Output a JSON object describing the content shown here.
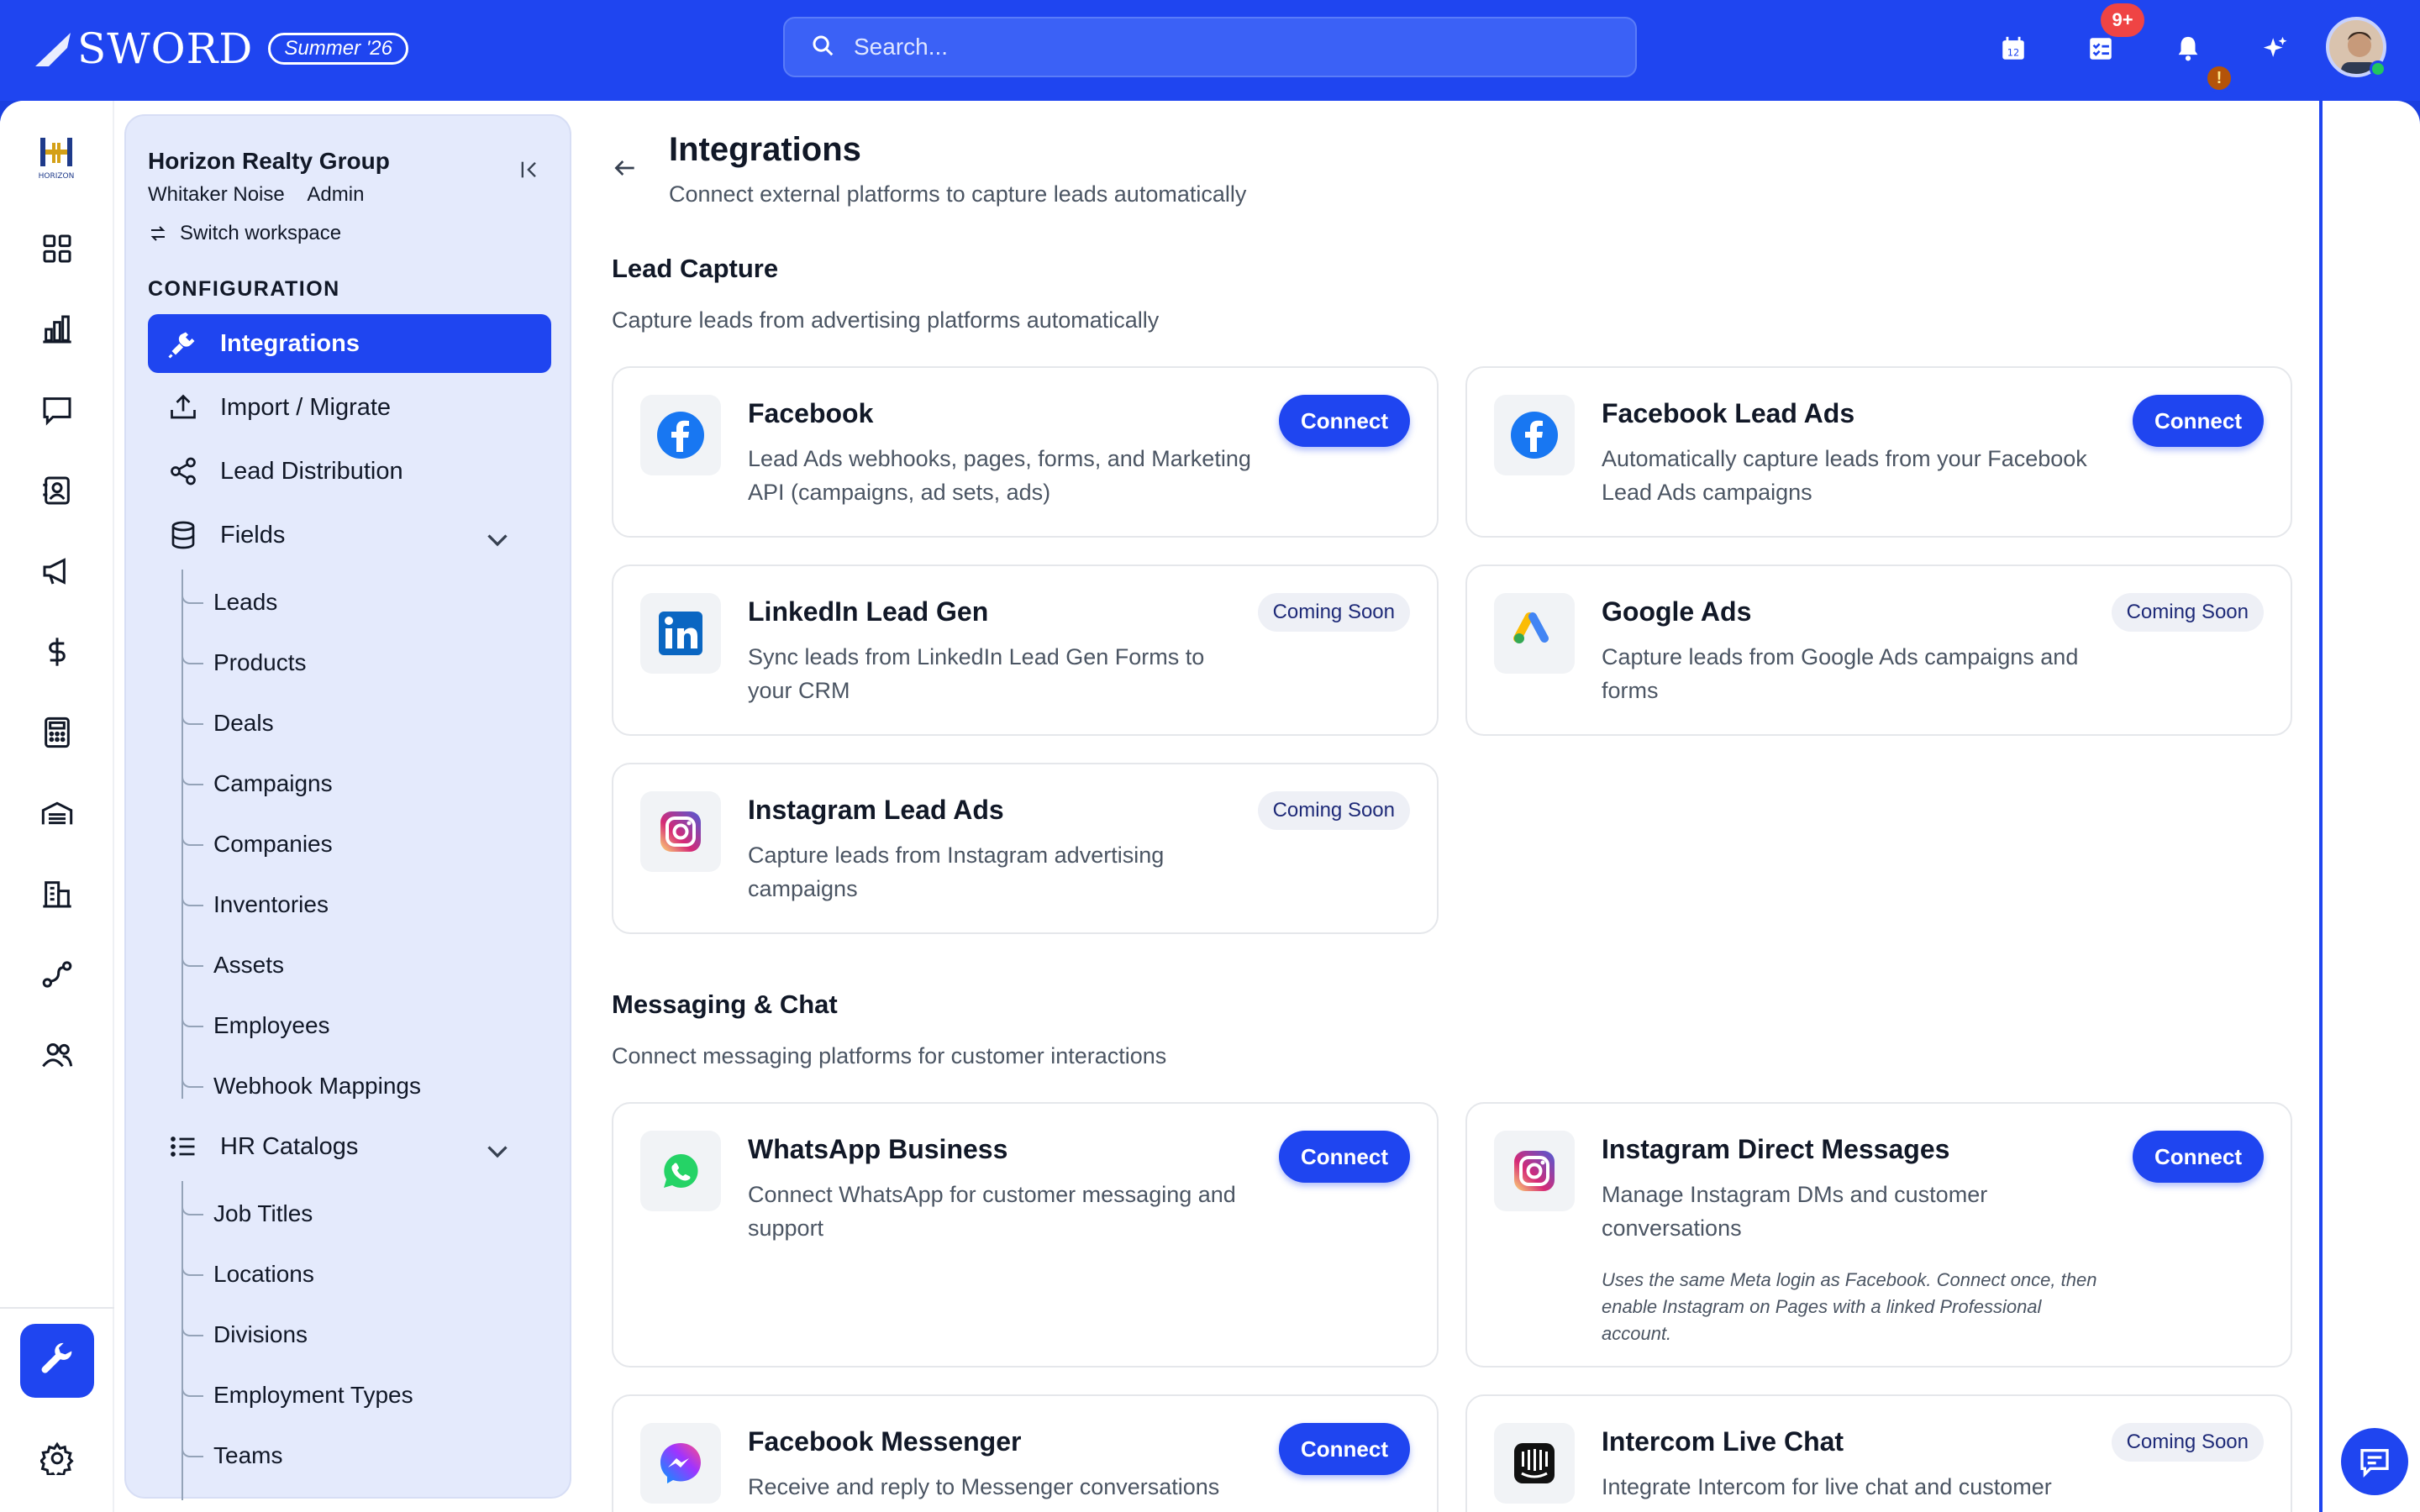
{
  "brand": {
    "name": "SWORD",
    "release": "Summer '26"
  },
  "search": {
    "placeholder": "Search..."
  },
  "notifications": {
    "task_count": "9+",
    "alert_glyph": "!"
  },
  "colors": {
    "primary": "#1f45f0",
    "panel": "#e4eafc",
    "badge_red": "#ef4444",
    "online": "#22c55e"
  },
  "rail": {
    "icons": [
      "dashboard-icon",
      "analytics-icon",
      "messages-icon",
      "contacts-icon",
      "campaigns-icon",
      "finance-icon",
      "calculator-icon",
      "warehouse-icon",
      "buildings-icon",
      "workflow-icon",
      "team-icon"
    ],
    "active": "tools-icon",
    "bottom": "settings-icon"
  },
  "workspace": {
    "org": "Horizon Realty Group",
    "user": "Whitaker Noise",
    "role": "Admin",
    "switch_label": "Switch workspace"
  },
  "sidebar": {
    "section": "CONFIGURATION",
    "items": [
      {
        "label": "Integrations",
        "icon": "plug-icon"
      },
      {
        "label": "Import / Migrate",
        "icon": "upload-icon"
      },
      {
        "label": "Lead Distribution",
        "icon": "share-icon"
      },
      {
        "label": "Fields",
        "icon": "database-icon"
      },
      {
        "label": "HR Catalogs",
        "icon": "list-icon"
      }
    ],
    "fields": [
      "Leads",
      "Products",
      "Deals",
      "Campaigns",
      "Companies",
      "Inventories",
      "Assets",
      "Employees",
      "Webhook Mappings"
    ],
    "hr": [
      "Job Titles",
      "Locations",
      "Divisions",
      "Employment Types",
      "Teams"
    ]
  },
  "page": {
    "title": "Integrations",
    "subtitle": "Connect external platforms to capture leads automatically"
  },
  "lead_capture": {
    "title": "Lead Capture",
    "subtitle": "Capture leads from advertising platforms automatically",
    "cards": [
      {
        "title": "Facebook",
        "desc": "Lead Ads webhooks, pages, forms, and Marketing API (campaigns, ad sets, ads)",
        "action": "Connect"
      },
      {
        "title": "Facebook Lead Ads",
        "desc": "Automatically capture leads from your Facebook Lead Ads campaigns",
        "action": "Connect"
      },
      {
        "title": "LinkedIn Lead Gen",
        "desc": "Sync leads from LinkedIn Lead Gen Forms to your CRM",
        "status": "Coming Soon"
      },
      {
        "title": "Google Ads",
        "desc": "Capture leads from Google Ads campaigns and forms",
        "status": "Coming Soon"
      },
      {
        "title": "Instagram Lead Ads",
        "desc": "Capture leads from Instagram advertising campaigns",
        "status": "Coming Soon"
      }
    ]
  },
  "messaging": {
    "title": "Messaging & Chat",
    "subtitle": "Connect messaging platforms for customer interactions",
    "cards": [
      {
        "title": "WhatsApp Business",
        "desc": "Connect WhatsApp for customer messaging and support",
        "action": "Connect"
      },
      {
        "title": "Instagram Direct Messages",
        "desc": "Manage Instagram DMs and customer conversations",
        "note": "Uses the same Meta login as Facebook. Connect once, then enable Instagram on Pages with a linked Professional account.",
        "action": "Connect"
      },
      {
        "title": "Facebook Messenger",
        "desc": "Receive and reply to Messenger conversations",
        "action": "Connect"
      },
      {
        "title": "Intercom Live Chat",
        "desc": "Integrate Intercom for live chat and customer",
        "status": "Coming Soon"
      }
    ]
  }
}
